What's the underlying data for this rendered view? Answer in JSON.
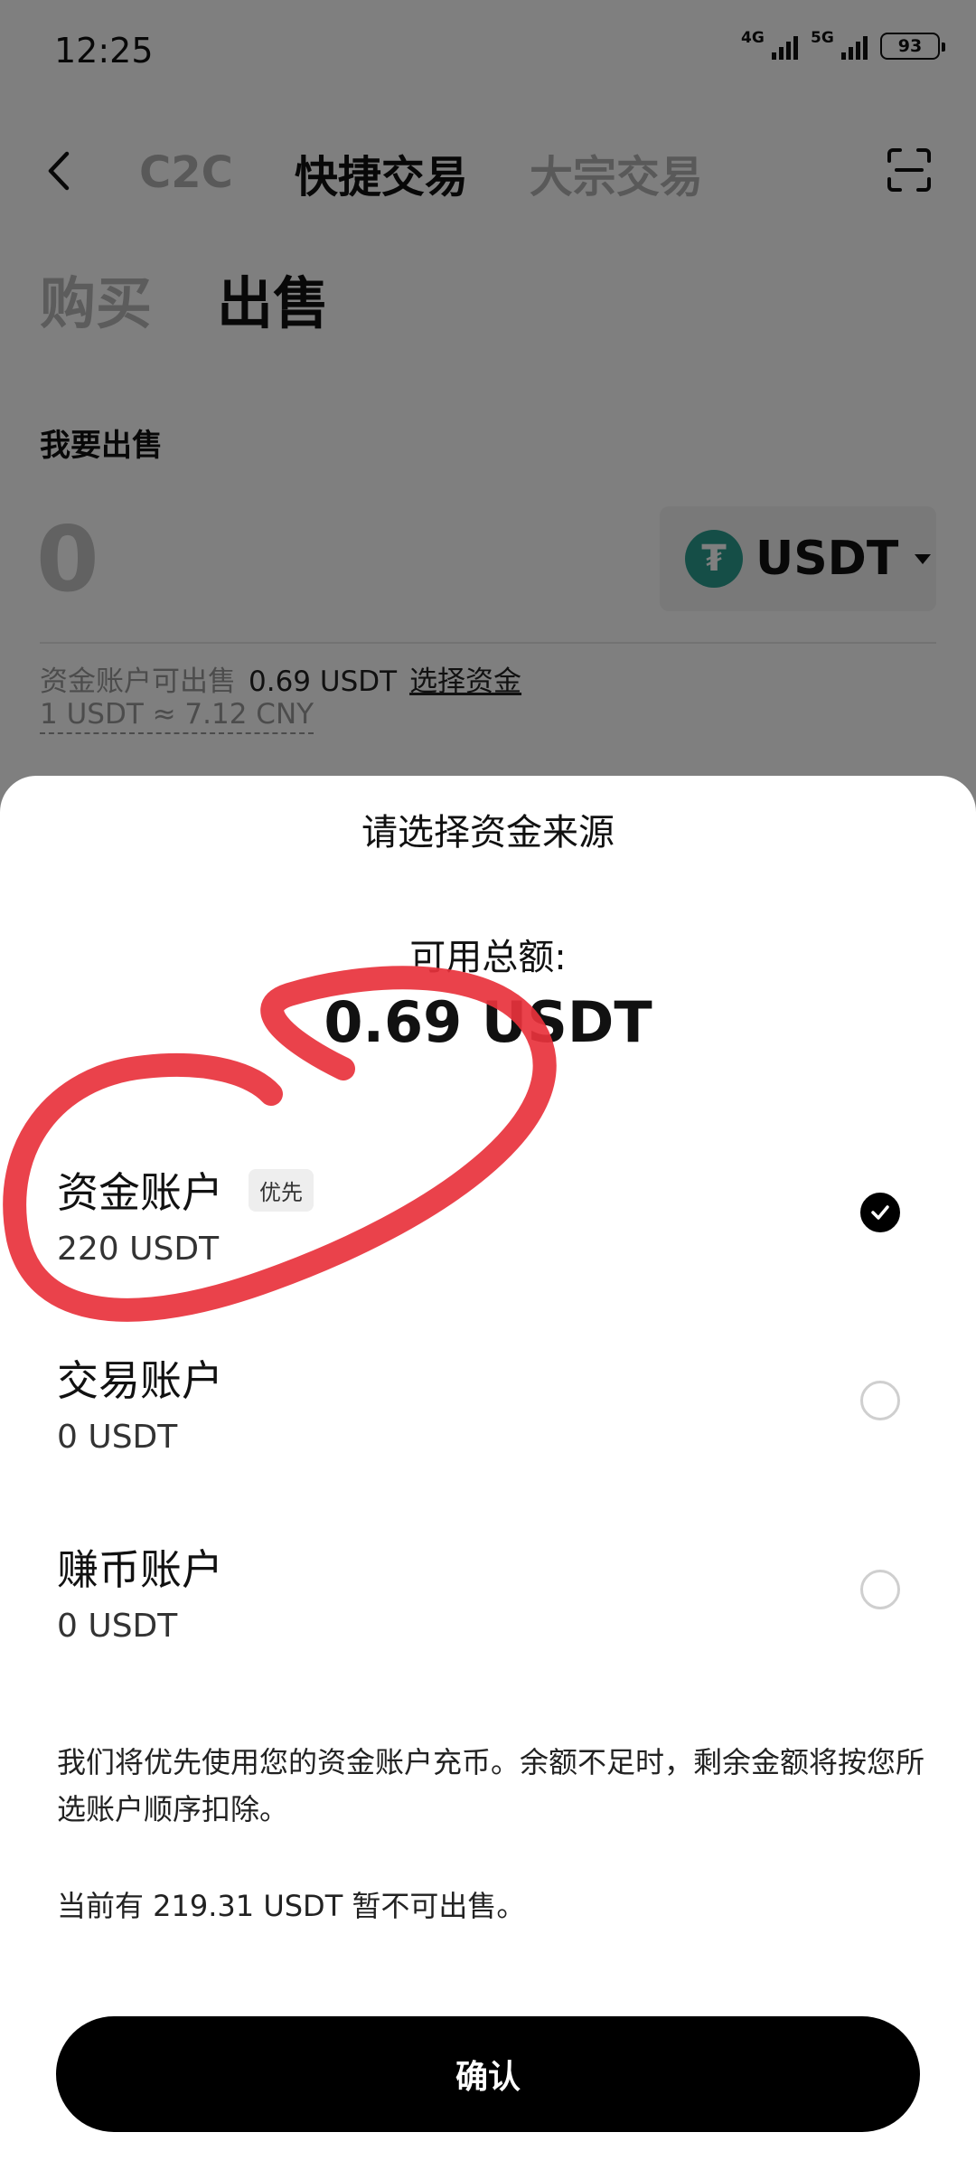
{
  "status": {
    "time": "12:25",
    "net1": "4G",
    "net2": "5G",
    "battery": "93"
  },
  "nav": {
    "tabs": [
      "C2C",
      "快捷交易",
      "大宗交易"
    ],
    "active_tab": 1
  },
  "subtabs": {
    "buy": "购买",
    "sell": "出售"
  },
  "sell_form": {
    "label": "我要出售",
    "amount_placeholder": "0",
    "currency": "USDT",
    "available_prefix": "资金账户可出售",
    "available_value": "0.69 USDT",
    "select_funds": "选择资金",
    "rate": "1 USDT ≈ 7.12 CNY"
  },
  "sheet": {
    "title": "请选择资金来源",
    "total_label": "可用总额:",
    "total_value": "0.69 USDT",
    "accounts": [
      {
        "name": "资金账户",
        "badge": "优先",
        "balance": "220 USDT",
        "selected": true
      },
      {
        "name": "交易账户",
        "balance": "0 USDT",
        "selected": false
      },
      {
        "name": "赚币账户",
        "balance": "0 USDT",
        "selected": false
      }
    ],
    "note": "我们将优先使用您的资金账户充币。余额不足时，剩余金额将按您所选账户顺序扣除。",
    "note2": "当前有 219.31 USDT 暂不可出售。",
    "confirm": "确认"
  },
  "colors": {
    "accent": "#000000",
    "tether": "#2a9d8f",
    "annotation": "#e8323c"
  }
}
